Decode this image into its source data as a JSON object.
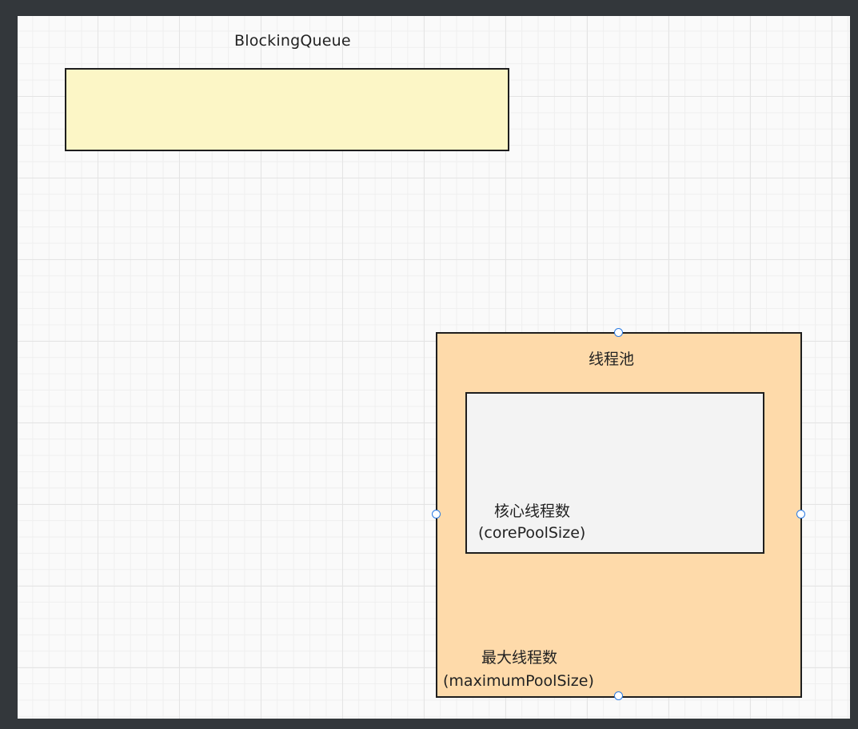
{
  "diagram": {
    "blocking_queue": {
      "label": "BlockingQueue",
      "fill": "#fcf6c6"
    },
    "thread_pool": {
      "label": "线程池",
      "fill": "#fedaaa",
      "core": {
        "label": "核心线程数",
        "sub_label": "(corePoolSize)",
        "fill": "#f3f3f3"
      },
      "max": {
        "label": "最大线程数",
        "sub_label": "(maximumPoolSize)"
      }
    },
    "selection_handle_color": "#2a7be4",
    "canvas_background": "#fafafa",
    "frame_background": "#33373b"
  }
}
